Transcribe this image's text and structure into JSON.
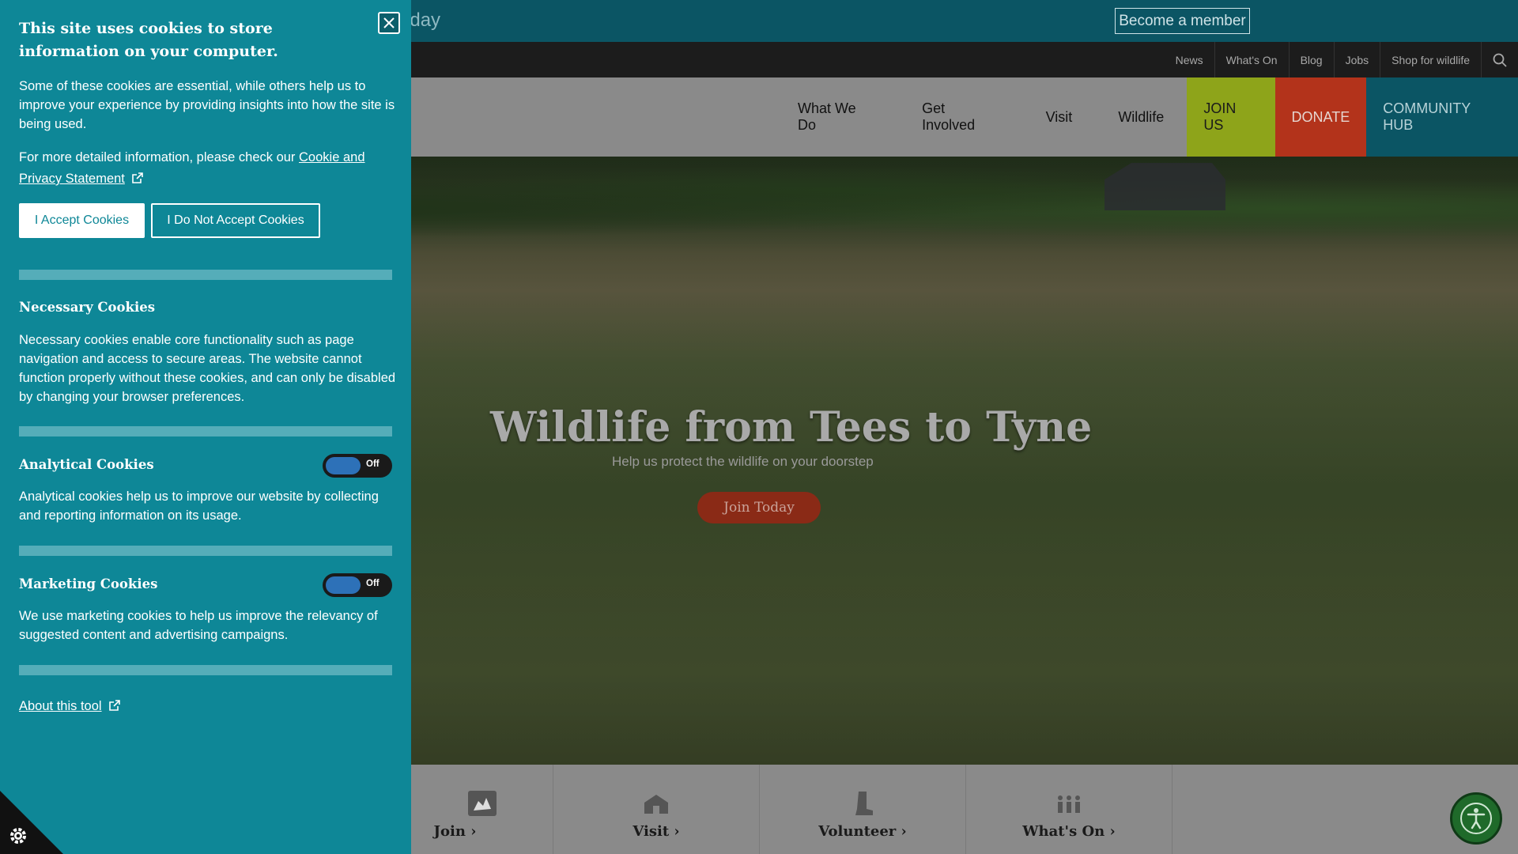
{
  "banner": {
    "text": "oday",
    "become_member": "Become a member"
  },
  "utility_nav": [
    "News",
    "What's On",
    "Blog",
    "Jobs",
    "Shop for wildlife"
  ],
  "main_nav": {
    "items": [
      "What We Do",
      "Get Involved",
      "Visit",
      "Wildlife"
    ],
    "join": "JOIN US",
    "donate": "DONATE",
    "hub": "COMMUNITY HUB"
  },
  "hero": {
    "title": "Wildlife from Tees to Tyne",
    "subtitle": "Help us protect the wildlife on your doorstep",
    "cta": "Join Today"
  },
  "quick_links": [
    {
      "label": "Join",
      "icon": "hand-icon"
    },
    {
      "label": "Visit",
      "icon": "house-icon"
    },
    {
      "label": "Volunteer",
      "icon": "boot-icon"
    },
    {
      "label": "What's On",
      "icon": "people-icon"
    }
  ],
  "cookie": {
    "title": "This site uses cookies to store information on your computer.",
    "intro": "Some of these cookies are essential, while others help us to improve your experience by providing insights into how the site is being used.",
    "more_info_prefix": "For more detailed information, please check our ",
    "more_info_link": "Cookie and Privacy Statement",
    "accept": "I Accept Cookies",
    "reject": "I Do Not Accept Cookies",
    "necessary_title": "Necessary Cookies",
    "necessary_text": "Necessary cookies enable core functionality such as page navigation and access to secure areas. The website cannot function properly without these cookies, and can only be disabled by changing your browser preferences.",
    "analytical_title": "Analytical Cookies",
    "analytical_text": "Analytical cookies help us to improve our website by collecting and reporting information on its usage.",
    "marketing_title": "Marketing Cookies",
    "marketing_text": "We use marketing cookies to help us improve the relevancy of suggested content and advertising campaigns.",
    "toggle_off": "Off",
    "about_link": "About this tool"
  },
  "colors": {
    "cookie_panel": "#0e8797",
    "join_us": "#8ea41a",
    "donate": "#b3331b",
    "community_hub": "#0b5564"
  }
}
